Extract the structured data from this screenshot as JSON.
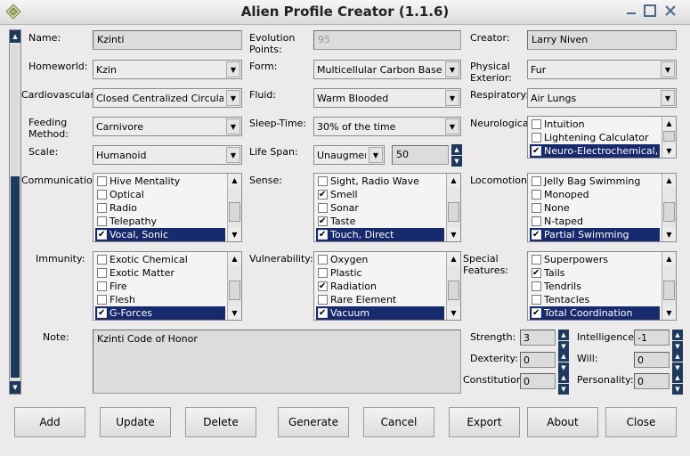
{
  "window": {
    "title": "Alien Profile Creator (1.1.6)"
  },
  "fields": {
    "name": {
      "label": "Name:",
      "value": "Kzinti"
    },
    "evolution_points": {
      "label": "Evolution Points:",
      "value": "95"
    },
    "creator": {
      "label": "Creator:",
      "value": "Larry Niven"
    },
    "homeworld": {
      "label": "Homeworld:",
      "value": "Kzin"
    },
    "form": {
      "label": "Form:",
      "value": "Multicellular Carbon Based"
    },
    "physical_exterior": {
      "label": "Physical Exterior:",
      "value": "Fur"
    },
    "cardiovascular": {
      "label": "Cardiovascular:",
      "value": "Closed Centralized Circulatory"
    },
    "fluid": {
      "label": "Fluid:",
      "value": "Warm Blooded"
    },
    "respiratory": {
      "label": "Respiratory:",
      "value": "Air Lungs"
    },
    "feeding_method": {
      "label": "Feeding Method:",
      "value": "Carnivore"
    },
    "sleep_time": {
      "label": "Sleep-Time:",
      "value": "30% of the time"
    },
    "scale": {
      "label": "Scale:",
      "value": "Humanoid"
    },
    "life_span": {
      "label": "Life Span:",
      "unit": "Unaugment",
      "value": "50"
    },
    "note": {
      "label": "Note:",
      "value": "Kzinti Code of Honor"
    }
  },
  "lists": {
    "neurological": {
      "label": "Neurological:",
      "items": [
        {
          "text": "Intuition",
          "checked": false,
          "selected": false
        },
        {
          "text": "Lightening Calculator",
          "checked": false,
          "selected": false
        },
        {
          "text": "Neuro-Electrochemical, Cen",
          "checked": true,
          "selected": true
        }
      ]
    },
    "communication": {
      "label": "Communication:",
      "items": [
        {
          "text": "Hive Mentality",
          "checked": false,
          "selected": false
        },
        {
          "text": "Optical",
          "checked": false,
          "selected": false
        },
        {
          "text": "Radio",
          "checked": false,
          "selected": false
        },
        {
          "text": "Telepathy",
          "checked": false,
          "selected": false
        },
        {
          "text": "Vocal, Sonic",
          "checked": true,
          "selected": true
        }
      ]
    },
    "sense": {
      "label": "Sense:",
      "items": [
        {
          "text": "Sight, Radio Wave",
          "checked": false,
          "selected": false
        },
        {
          "text": "Smell",
          "checked": true,
          "selected": false
        },
        {
          "text": "Sonar",
          "checked": false,
          "selected": false
        },
        {
          "text": "Taste",
          "checked": true,
          "selected": false
        },
        {
          "text": "Touch, Direct",
          "checked": true,
          "selected": true
        }
      ]
    },
    "locomotion": {
      "label": "Locomotion:",
      "items": [
        {
          "text": "Jelly Bag Swimming",
          "checked": false,
          "selected": false
        },
        {
          "text": "Monoped",
          "checked": false,
          "selected": false
        },
        {
          "text": "None",
          "checked": false,
          "selected": false
        },
        {
          "text": "N-taped",
          "checked": false,
          "selected": false
        },
        {
          "text": "Partial Swimming",
          "checked": true,
          "selected": true
        }
      ]
    },
    "immunity": {
      "label": "Immunity:",
      "items": [
        {
          "text": "Exotic Chemical",
          "checked": false,
          "selected": false
        },
        {
          "text": "Exotic Matter",
          "checked": false,
          "selected": false
        },
        {
          "text": "Fire",
          "checked": false,
          "selected": false
        },
        {
          "text": "Flesh",
          "checked": false,
          "selected": false
        },
        {
          "text": "G-Forces",
          "checked": true,
          "selected": true
        }
      ]
    },
    "vulnerability": {
      "label": "Vulnerability:",
      "items": [
        {
          "text": "Oxygen",
          "checked": false,
          "selected": false
        },
        {
          "text": "Plastic",
          "checked": false,
          "selected": false
        },
        {
          "text": "Radiation",
          "checked": true,
          "selected": false
        },
        {
          "text": "Rare Element",
          "checked": false,
          "selected": false
        },
        {
          "text": "Vacuum",
          "checked": true,
          "selected": true
        }
      ]
    },
    "special_features": {
      "label": "Special Features:",
      "items": [
        {
          "text": "Superpowers",
          "checked": false,
          "selected": false
        },
        {
          "text": "Tails",
          "checked": true,
          "selected": false
        },
        {
          "text": "Tendrils",
          "checked": false,
          "selected": false
        },
        {
          "text": "Tentacles",
          "checked": false,
          "selected": false
        },
        {
          "text": "Total Coordination",
          "checked": true,
          "selected": true
        }
      ]
    }
  },
  "stats": {
    "strength": {
      "label": "Strength:",
      "value": "3"
    },
    "dexterity": {
      "label": "Dexterity:",
      "value": "0"
    },
    "constitution": {
      "label": "Constitution:",
      "value": "0"
    },
    "intelligence": {
      "label": "Intelligence:",
      "value": "-1"
    },
    "will": {
      "label": "Will:",
      "value": "0"
    },
    "personality": {
      "label": "Personality:",
      "value": "0"
    }
  },
  "buttons": {
    "add": "Add",
    "update": "Update",
    "delete": "Delete",
    "generate": "Generate",
    "cancel": "Cancel",
    "export": "Export",
    "about": "About",
    "close": "Close"
  },
  "colors": {
    "selection": "#172a6e",
    "accent": "#1d3a5c"
  }
}
